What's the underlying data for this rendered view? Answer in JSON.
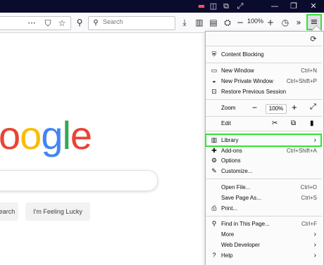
{
  "titlebar": {
    "minimize": "—",
    "restore": "❐",
    "close": "✕"
  },
  "toolbar": {
    "search_placeholder": "Search",
    "zoom_level": "100%",
    "icons": [
      "reader-mode-icon",
      "pocket-icon",
      "bookmark-star-icon",
      "search-icon",
      "download-icon",
      "library-icon",
      "sidebar-icon",
      "profile-icon",
      "zoom-out-icon",
      "zoom-in-icon",
      "history-icon",
      "overflow-icon",
      "hamburger-menu-icon"
    ]
  },
  "page": {
    "logo_letters": [
      {
        "ch": "o",
        "color": "#ea4335"
      },
      {
        "ch": "o",
        "color": "#fbbc05"
      },
      {
        "ch": "g",
        "color": "#4285f4"
      },
      {
        "ch": "l",
        "color": "#34a853"
      },
      {
        "ch": "e",
        "color": "#ea4335"
      }
    ],
    "search_button": "earch",
    "lucky_button": "I'm Feeling Lucky"
  },
  "menu": {
    "content_blocking": "Content Blocking",
    "new_window": "New Window",
    "new_window_sc": "Ctrl+N",
    "new_private": "New Private Window",
    "new_private_sc": "Ctrl+Shift+P",
    "restore": "Restore Previous Session",
    "zoom": "Zoom",
    "zoom_value": "100%",
    "edit": "Edit",
    "library": "Library",
    "addons": "Add-ons",
    "addons_sc": "Ctrl+Shift+A",
    "options": "Options",
    "customize": "Customize...",
    "open_file": "Open File...",
    "open_file_sc": "Ctrl+O",
    "save_page": "Save Page As...",
    "save_page_sc": "Ctrl+S",
    "print": "Print...",
    "find": "Find in This Page...",
    "find_sc": "Ctrl+F",
    "more": "More",
    "web_dev": "Web Developer",
    "help": "Help"
  },
  "colors": {
    "highlight": "#35e335",
    "titlebar": "#0b0b2e"
  }
}
